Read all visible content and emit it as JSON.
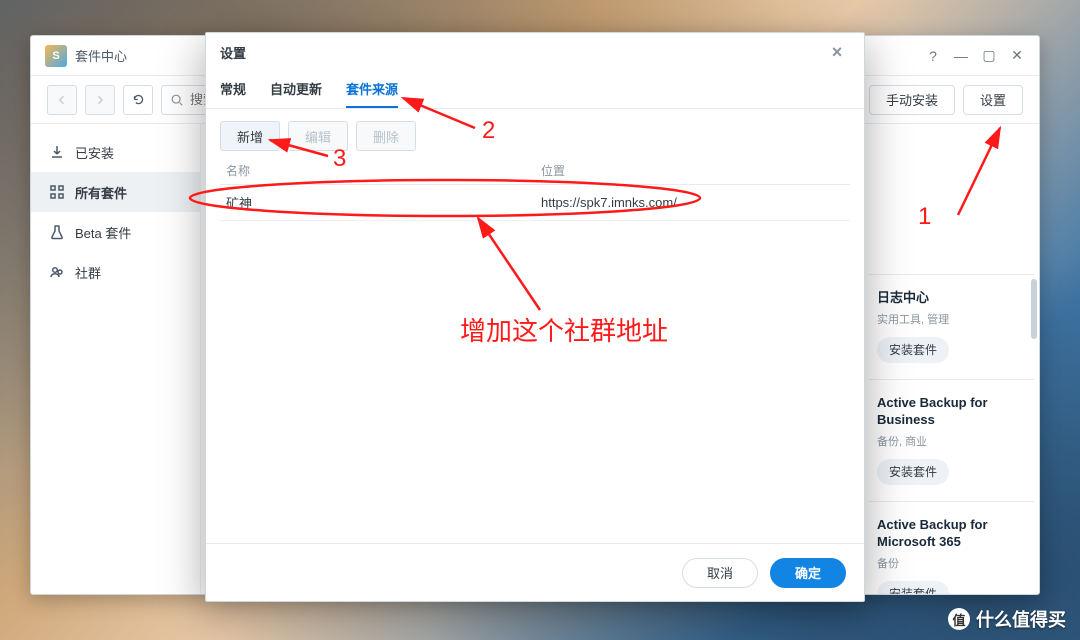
{
  "main_window": {
    "title": "套件中心",
    "toolbar": {
      "search_placeholder": "搜索",
      "manual_install": "手动安装",
      "settings": "设置"
    }
  },
  "sidebar": {
    "items": [
      {
        "id": "installed",
        "label": "已安装"
      },
      {
        "id": "all",
        "label": "所有套件"
      },
      {
        "id": "beta",
        "label": "Beta 套件"
      },
      {
        "id": "community",
        "label": "社群"
      }
    ]
  },
  "packages": [
    {
      "title": "日志中心",
      "sub": "实用工具, 管理",
      "action": "安装套件"
    },
    {
      "title": "Active Backup for Business",
      "sub": "备份, 商业",
      "action": "安装套件"
    },
    {
      "title": "Active Backup for Microsoft 365",
      "sub": "备份",
      "action": "安装套件"
    }
  ],
  "modal": {
    "title": "设置",
    "tabs": {
      "general": "常规",
      "auto_update": "自动更新",
      "sources": "套件来源"
    },
    "buttons": {
      "add": "新增",
      "edit": "编辑",
      "delete": "删除"
    },
    "columns": {
      "name": "名称",
      "location": "位置"
    },
    "rows": [
      {
        "name": "矿神",
        "location": "https://spk7.imnks.com/"
      }
    ],
    "footer": {
      "cancel": "取消",
      "ok": "确定"
    }
  },
  "annotations": {
    "n1": "1",
    "n2": "2",
    "n3": "3",
    "hint": "增加这个社群地址"
  },
  "watermark": "什么值得买"
}
